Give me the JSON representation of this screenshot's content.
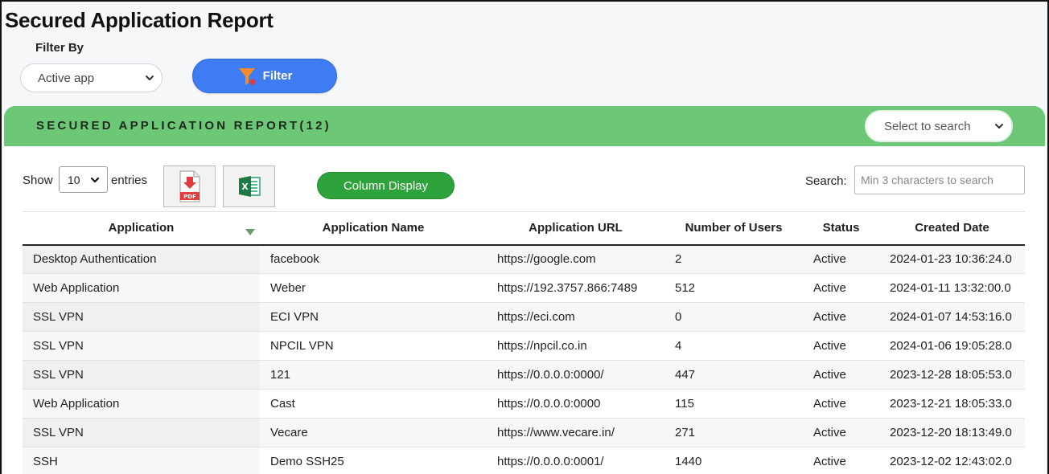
{
  "page": {
    "title": "Secured Application Report"
  },
  "filter": {
    "label": "Filter By",
    "selected": "Active app",
    "button_label": "Filter"
  },
  "report": {
    "title": "SECURED APPLICATION REPORT(12)",
    "search_select_placeholder": "Select to search",
    "show_label": "Show",
    "entries_value": "10",
    "entries_label": "entries",
    "column_display_label": "Column Display",
    "search_label": "Search:",
    "search_placeholder": "Min 3 characters to search"
  },
  "table": {
    "columns": [
      "Application",
      "Application Name",
      "Application URL",
      "Number of Users",
      "Status",
      "Created Date"
    ],
    "rows": [
      [
        "Desktop Authentication",
        "facebook",
        "https://google.com",
        "2",
        "Active",
        "2024-01-23 10:36:24.0"
      ],
      [
        "Web Application",
        "Weber",
        "https://192.3757.866:7489",
        "512",
        "Active",
        "2024-01-11 13:32:00.0"
      ],
      [
        "SSL VPN",
        "ECI VPN",
        "https://eci.com",
        "0",
        "Active",
        "2024-01-07 14:53:16.0"
      ],
      [
        "SSL VPN",
        "NPCIL VPN",
        "https://npcil.co.in",
        "4",
        "Active",
        "2024-01-06 19:05:28.0"
      ],
      [
        "SSL VPN",
        "121",
        "https://0.0.0.0:0000/",
        "447",
        "Active",
        "2023-12-28 18:05:53.0"
      ],
      [
        "Web Application",
        "Cast",
        "https://0.0.0.0:0000",
        "115",
        "Active",
        "2023-12-21 18:05:33.0"
      ],
      [
        "SSL VPN",
        "Vecare",
        "https://www.vecare.in/",
        "271",
        "Active",
        "2023-12-20 18:13:49.0"
      ],
      [
        "SSH",
        "Demo SSH25",
        "https://0.0.0.0:0001/",
        "1440",
        "Active",
        "2023-12-02 12:43:02.0"
      ]
    ]
  },
  "colors": {
    "header_green": "#6cc776",
    "filter_blue": "#3d7cf2",
    "column_btn_green": "#2ea33b"
  },
  "icons": [
    "chevron-down-icon",
    "funnel-icon",
    "pdf-icon",
    "excel-icon",
    "sort-desc-icon"
  ]
}
